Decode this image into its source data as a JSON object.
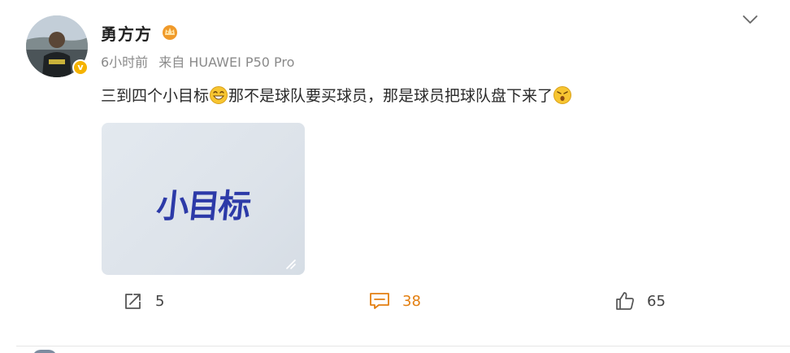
{
  "post": {
    "author": {
      "name": "勇方方",
      "avatar_icon": "user-avatar-photo",
      "verified_icon": "verified-badge-icon",
      "verified_glyph": "v",
      "member_icon": "crown-icon",
      "colors": {
        "verified": "#f5b300",
        "member": "#f09a2a"
      }
    },
    "meta": {
      "time": "6小时前",
      "source": "来自 HUAWEI P50 Pro"
    },
    "content": {
      "part1": "三到四个小目标",
      "emoji1": "grin-emoji",
      "part2": "那不是球队要买球员，那是球员把球队盘下来了",
      "emoji2": "shocked-emoji"
    },
    "image": {
      "title": "小目标",
      "colors": {
        "background": "#e0e6ec",
        "text": "#2c3aa8"
      }
    },
    "actions": {
      "repost": {
        "icon": "share-icon",
        "count": "5"
      },
      "comment": {
        "icon": "comment-icon",
        "count": "38",
        "color": "#e37f10"
      },
      "like": {
        "icon": "thumbs-up-icon",
        "count": "65"
      }
    }
  }
}
